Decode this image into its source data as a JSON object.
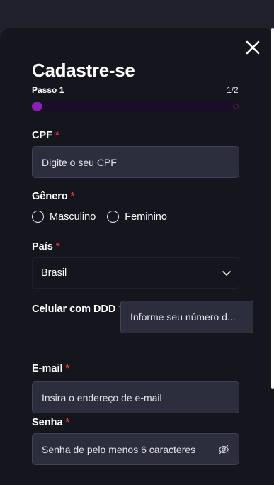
{
  "dialog": {
    "title": "Cadastre-se",
    "step_label": "Passo 1",
    "step_count": "1/2",
    "progress": 0.05
  },
  "fields": {
    "cpf": {
      "label": "CPF",
      "required_mark": "*",
      "placeholder": "Digite o seu CPF"
    },
    "gender": {
      "label": "Gênero",
      "required_mark": "*",
      "options": [
        "Masculino",
        "Feminino"
      ]
    },
    "country": {
      "label": "País",
      "required_mark": "*",
      "value": "Brasil"
    },
    "phone": {
      "label": "Celular com DDD",
      "required_mark": "*",
      "placeholder": "Informe seu número d..."
    },
    "email": {
      "label": "E-mail",
      "required_mark": "*",
      "placeholder": "Insira o endereço de e-mail"
    },
    "password": {
      "label": "Senha",
      "required_mark": "*",
      "placeholder": "Senha de pelo menos 6 caracteres"
    }
  },
  "icons": {
    "close": "close-icon",
    "chevron": "chevron-down-icon",
    "eye": "eye-off-icon"
  },
  "colors": {
    "accent": "#8a1fb8",
    "required": "#e0323d",
    "modal_bg": "#15161d",
    "input_bg": "#2c2e3d"
  }
}
